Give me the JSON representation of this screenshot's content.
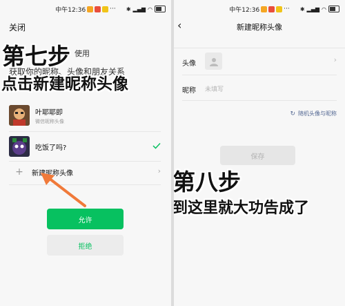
{
  "status_bar": {
    "time": "中午12:36"
  },
  "left": {
    "close_label": "关闭",
    "bg_line1": "使用",
    "bg_line2": "获取你的昵称、头像和朋友关系",
    "overlay_title": "第七步",
    "overlay_subtitle": "点击新建昵称头像",
    "accounts": [
      {
        "name": "叶耶耶即",
        "sub": "微信昵称头像"
      },
      {
        "name": "吃饭了吗?",
        "sub": ""
      }
    ],
    "new_profile_label": "新建昵称头像",
    "allow_button": "允许",
    "reject_button": "拒绝",
    "colors": {
      "accent": "#07c160",
      "check": "#07c160",
      "arrow": "#f07a3a"
    }
  },
  "right": {
    "title": "新建昵称头像",
    "avatar_label": "头像",
    "nickname_label": "昵称",
    "nickname_placeholder": "未填写",
    "random_label": "随机头像与昵称",
    "save_button": "保存",
    "overlay_title": "第八步",
    "overlay_subtitle": "到这里就大功告成了"
  }
}
